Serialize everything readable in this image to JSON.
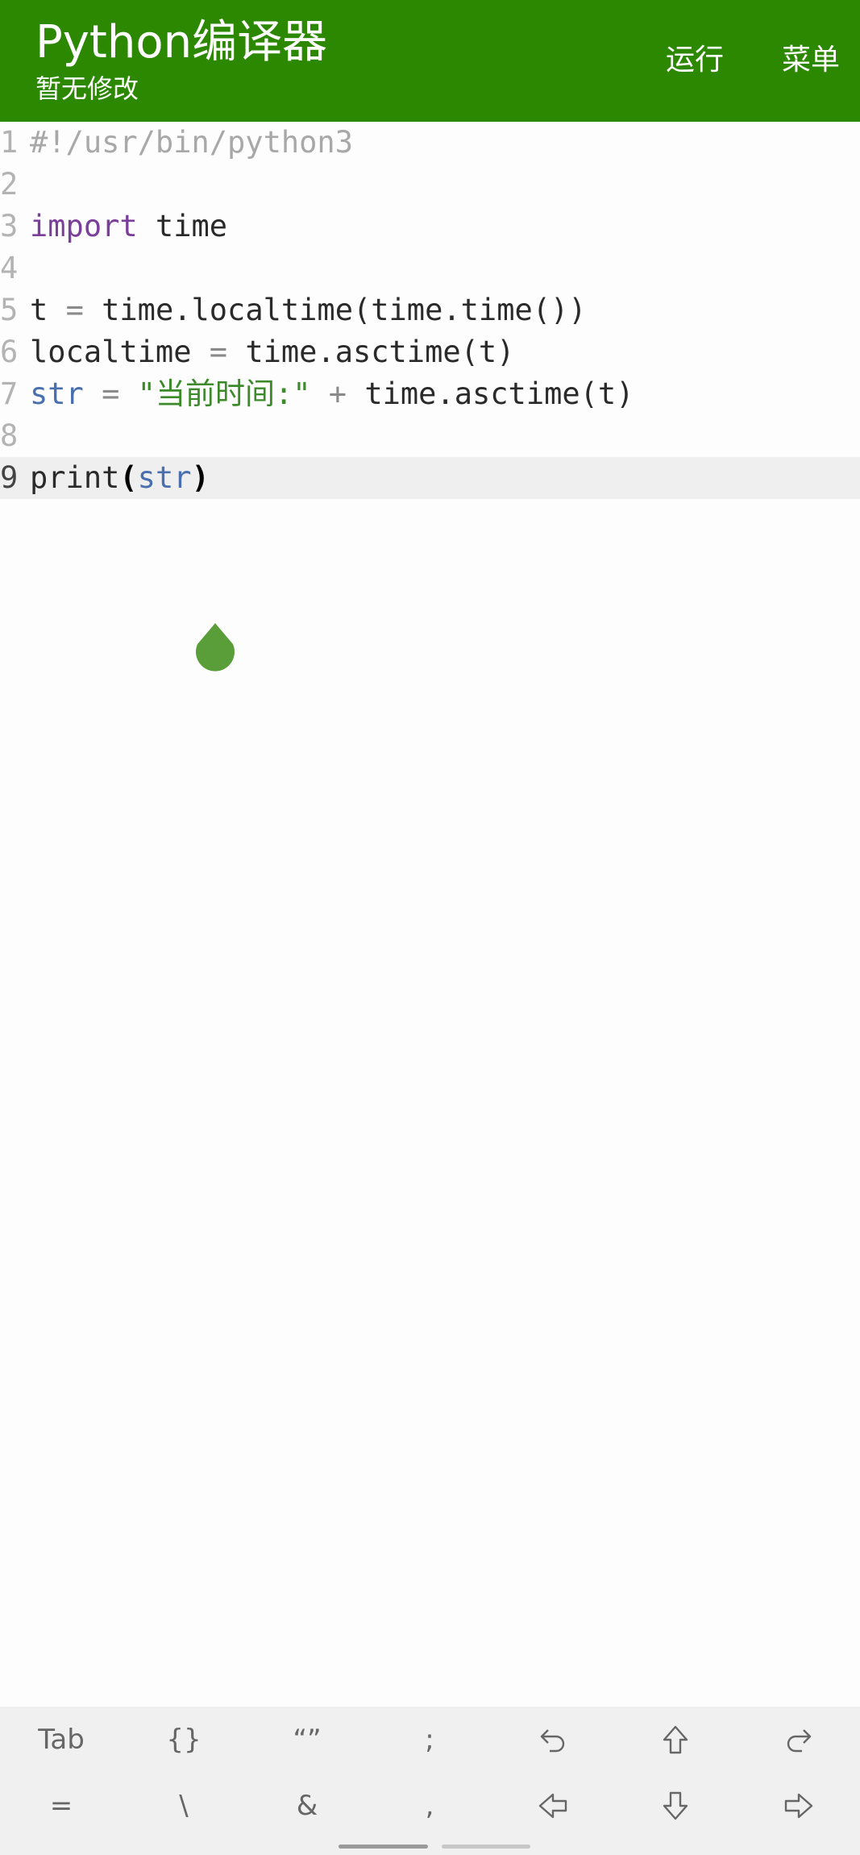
{
  "header": {
    "title": "Python编译器",
    "subtitle": "暂无修改",
    "run_label": "运行",
    "menu_label": "菜单",
    "background_color": "#2b8800"
  },
  "editor": {
    "current_line": 9,
    "lines": [
      {
        "num": "1",
        "tokens": [
          {
            "t": "#!/usr/bin/python3",
            "k": "comment"
          }
        ]
      },
      {
        "num": "2",
        "tokens": []
      },
      {
        "num": "3",
        "tokens": [
          {
            "t": "import",
            "k": "keyword"
          },
          {
            "t": " time",
            "k": "plain"
          }
        ]
      },
      {
        "num": "4",
        "tokens": []
      },
      {
        "num": "5",
        "tokens": [
          {
            "t": "t ",
            "k": "plain"
          },
          {
            "t": "=",
            "k": "op"
          },
          {
            "t": " time.localtime(time.time())",
            "k": "plain"
          }
        ]
      },
      {
        "num": "6",
        "tokens": [
          {
            "t": "localtime ",
            "k": "plain"
          },
          {
            "t": "=",
            "k": "op"
          },
          {
            "t": " time.asctime(t)",
            "k": "plain"
          }
        ]
      },
      {
        "num": "7",
        "tokens": [
          {
            "t": "str",
            "k": "builtin"
          },
          {
            "t": " ",
            "k": "plain"
          },
          {
            "t": "=",
            "k": "op"
          },
          {
            "t": " ",
            "k": "plain"
          },
          {
            "t": "\"当前时间:\"",
            "k": "string"
          },
          {
            "t": " ",
            "k": "plain"
          },
          {
            "t": "+",
            "k": "op"
          },
          {
            "t": " time.asctime(t)",
            "k": "plain"
          }
        ]
      },
      {
        "num": "8",
        "tokens": []
      },
      {
        "num": "9",
        "tokens": [
          {
            "t": "print",
            "k": "plain"
          },
          {
            "t": "(",
            "k": "bracket"
          },
          {
            "t": "str",
            "k": "builtin"
          },
          {
            "t": ")",
            "k": "bracket"
          }
        ]
      }
    ],
    "colors": {
      "comment": "#a8a8a8",
      "keyword": "#7a3f98",
      "builtin": "#4a6fae",
      "string": "#3c8a2a",
      "cursor_handle": "#5a9e3a"
    }
  },
  "toolbar": {
    "row1": [
      {
        "label": "Tab",
        "icon": ""
      },
      {
        "label": "{}",
        "icon": ""
      },
      {
        "label": "“”",
        "icon": ""
      },
      {
        "label": ";",
        "icon": ""
      },
      {
        "label": "",
        "icon": "undo-icon"
      },
      {
        "label": "",
        "icon": "arrow-up-icon"
      },
      {
        "label": "",
        "icon": "redo-icon"
      }
    ],
    "row2": [
      {
        "label": "=",
        "icon": ""
      },
      {
        "label": "\\",
        "icon": ""
      },
      {
        "label": "&",
        "icon": ""
      },
      {
        "label": ",",
        "icon": ""
      },
      {
        "label": "",
        "icon": "arrow-left-icon"
      },
      {
        "label": "",
        "icon": "arrow-down-icon"
      },
      {
        "label": "",
        "icon": "arrow-right-icon"
      }
    ]
  }
}
